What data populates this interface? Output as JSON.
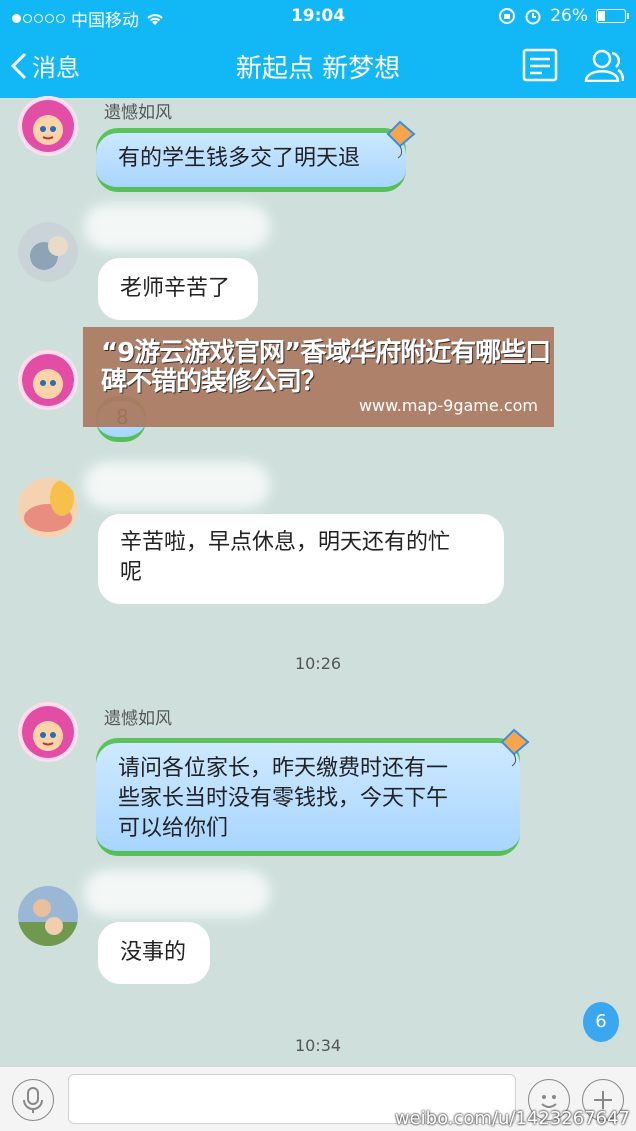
{
  "status": {
    "carrier": "中国移动",
    "time": "19:04",
    "battery": "26%",
    "battery_level": 0.26
  },
  "nav": {
    "back_label": "消息",
    "title": "新起点 新梦想"
  },
  "messages": [
    {
      "sender": "遗憾如风",
      "text": "有的学生钱多交了明天退"
    },
    {
      "text": "老师辛苦了"
    },
    {
      "text": "8"
    },
    {
      "text_line1": "辛苦啦，早点休息，明天还有的忙",
      "text_line2": "呢"
    },
    {
      "sender": "遗憾如风",
      "text_line1": "请问各位家长，昨天缴费时还有一",
      "text_line2": "些家长当时没有零钱找，今天下午",
      "text_line3": "可以给你们"
    },
    {
      "text": "没事的"
    }
  ],
  "times": {
    "t1": "10:26",
    "t2": "10:34"
  },
  "overlay": {
    "title": "“9游云游戏官网”香域华府附近有哪些口碑不错的装修公司？",
    "url": "www.map-9game.com"
  },
  "unread_badge": "6",
  "watermark": "weibo.com/u/1423267647",
  "colors": {
    "nav_bg": "#12b7f5",
    "chat_bg": "#cfe0dc",
    "blue_bubble": "#a8d5ff",
    "green_trim": "#55c055"
  }
}
